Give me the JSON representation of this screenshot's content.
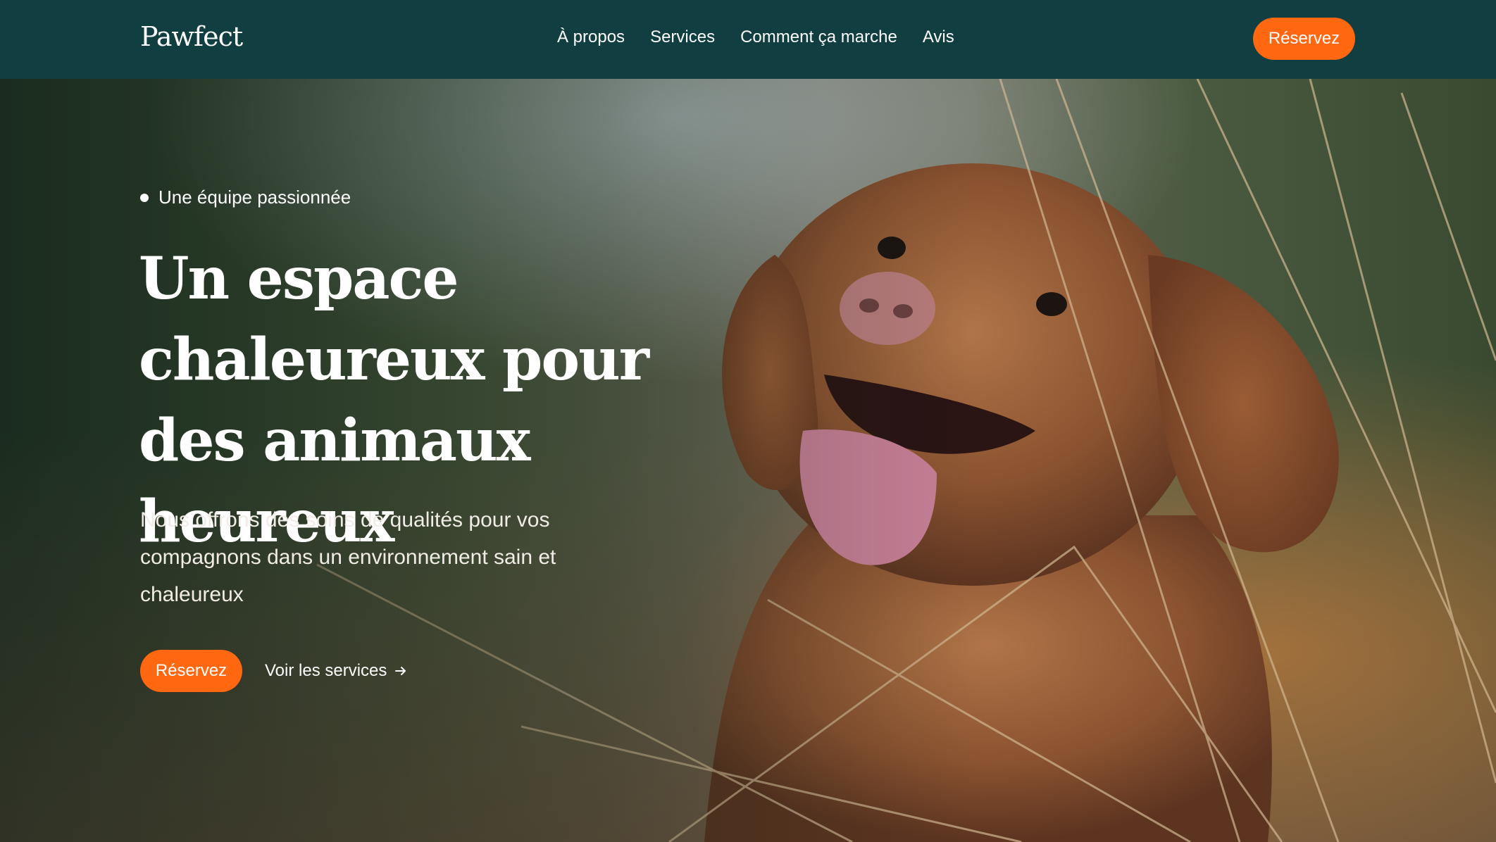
{
  "nav": {
    "logo": "Pawfect",
    "links": [
      "À propos",
      "Services",
      "Comment ça marche",
      "Avis"
    ],
    "cta_label": "Réservez"
  },
  "hero": {
    "eyebrow": "Une équipe passionnée",
    "headline": "Un espace chaleureux pour des animaux heureux",
    "subtext": "Nous offrons des soins de qualités pour vos compagnons dans un environnement sain et chaleureux",
    "primary_cta": "Réservez",
    "secondary_cta": "Voir les services",
    "secondary_icon": "arrow-right-icon",
    "image_description": ""
  },
  "colors": {
    "navbar_bg": "#113e40",
    "accent_orange": "#ff6710",
    "text_white": "#ffffff"
  }
}
